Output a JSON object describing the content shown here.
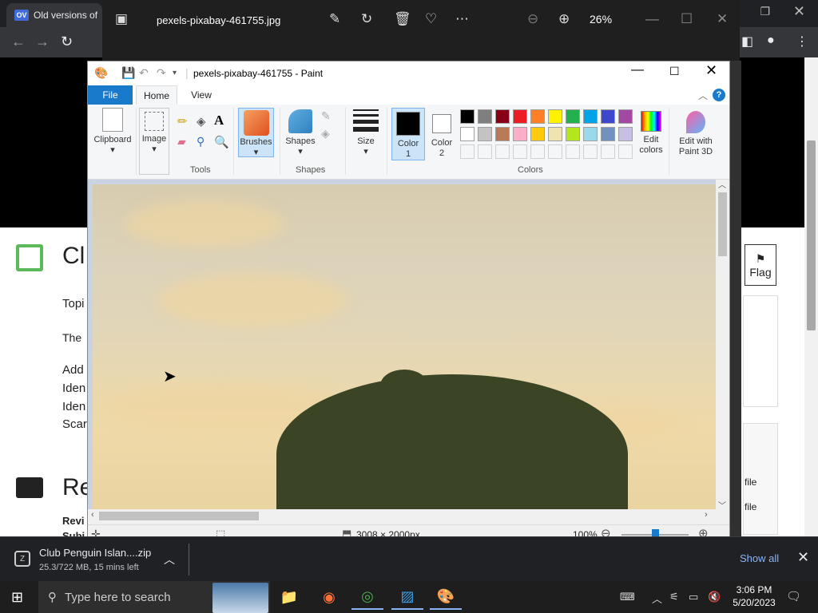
{
  "chrome": {
    "tab_badge": "OV",
    "tab_title": "Old versions of"
  },
  "web": {
    "heading1": "Cl",
    "topic": "Topi",
    "line_the": "The",
    "list": [
      "Add",
      "Iden",
      "Iden",
      "Scar"
    ],
    "heading2": "Re",
    "bold1": "Revi",
    "bold2": "Subi",
    "flag_label": "Flag",
    "file1": "file",
    "file2": "file"
  },
  "photos": {
    "filename": "pexels-pixabay-461755.jpg",
    "zoom": "26%"
  },
  "paint": {
    "title": "pexels-pixabay-461755 - Paint",
    "tabs": {
      "file": "File",
      "home": "Home",
      "view": "View"
    },
    "ribbon": {
      "clipboard": "Clipboard",
      "image": "Image",
      "tools_label": "Tools",
      "brushes": "Brushes",
      "shapes": "Shapes",
      "shapes_label": "Shapes",
      "size": "Size",
      "color1": "Color 1",
      "color2": "Color 2",
      "colors_label": "Colors",
      "edit_colors": "Edit colors",
      "edit_3d": "Edit with Paint 3D"
    },
    "palette_row1": [
      "#000000",
      "#7f7f7f",
      "#880015",
      "#ed1c24",
      "#ff7f27",
      "#fff200",
      "#22b14c",
      "#00a2e8",
      "#3f48cc",
      "#a349a4"
    ],
    "palette_row2": [
      "#ffffff",
      "#c3c3c3",
      "#b97a57",
      "#ffaec9",
      "#ffc90e",
      "#efe4b0",
      "#b5e61d",
      "#99d9ea",
      "#7092be",
      "#c8bfe7"
    ],
    "status": {
      "dimensions": "3008 × 2000px",
      "zoom": "100%"
    }
  },
  "download": {
    "name": "Club Penguin Islan....zip",
    "status": "25.3/722 MB, 15 mins left",
    "show_all": "Show all"
  },
  "taskbar": {
    "search_placeholder": "Type here to search",
    "time": "3:06 PM",
    "date": "5/20/2023"
  }
}
